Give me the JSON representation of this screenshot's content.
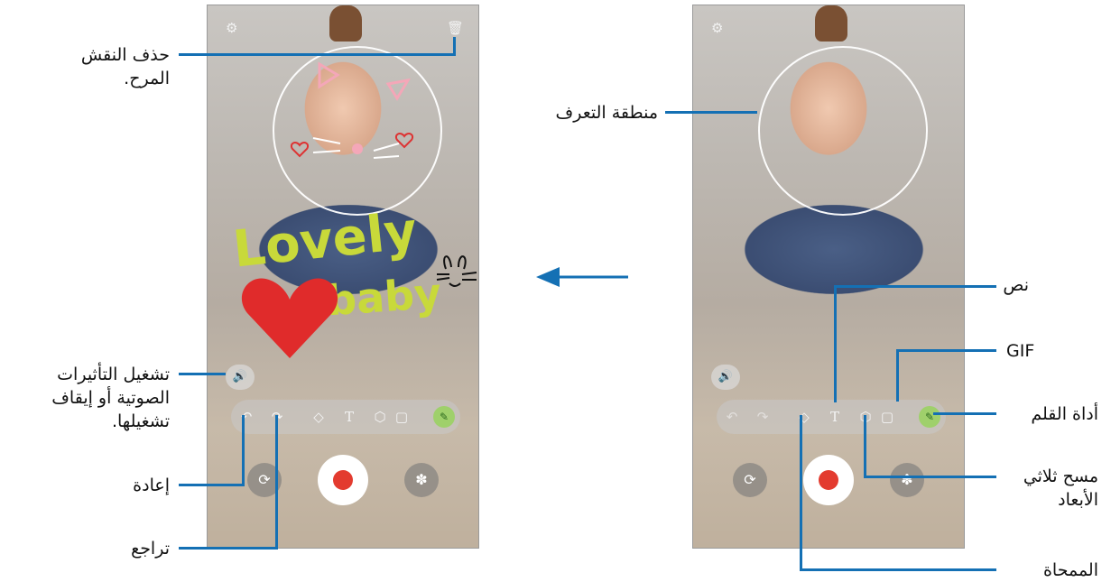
{
  "callouts": {
    "delete_doodle": [
      "حذف النقش",
      "المرح."
    ],
    "recognition_area": "منطقة التعرف",
    "sound_toggle": [
      "تشغيل التأثيرات",
      "الصوتية أو إيقاف",
      "تشغيلها."
    ],
    "redo": "إعادة",
    "undo": "تراجع",
    "text": "نص",
    "gif": "GIF",
    "pen_tool": "أداة القلم",
    "scan_3d": [
      "مسح ثلاثي",
      "الأبعاد"
    ],
    "eraser": "الممحاة"
  },
  "doodle": {
    "word1": "Lovely",
    "word2": "baby"
  },
  "icons": {
    "settings": "gear-icon",
    "trash": "trash-icon",
    "sound": "speaker-icon",
    "undo": "undo-icon",
    "redo": "redo-icon",
    "eraser": "eraser-icon",
    "text": "text-icon",
    "scan3d": "cube-icon",
    "gif": "gif-icon",
    "pen": "pen-icon",
    "switch_camera": "camera-switch-icon",
    "effects": "effects-icon"
  },
  "colors": {
    "callout_line": "#1470b4",
    "record": "#e33b2f",
    "doodle_yellow": "#c8d93a",
    "doodle_heart": "#e02b2b"
  }
}
